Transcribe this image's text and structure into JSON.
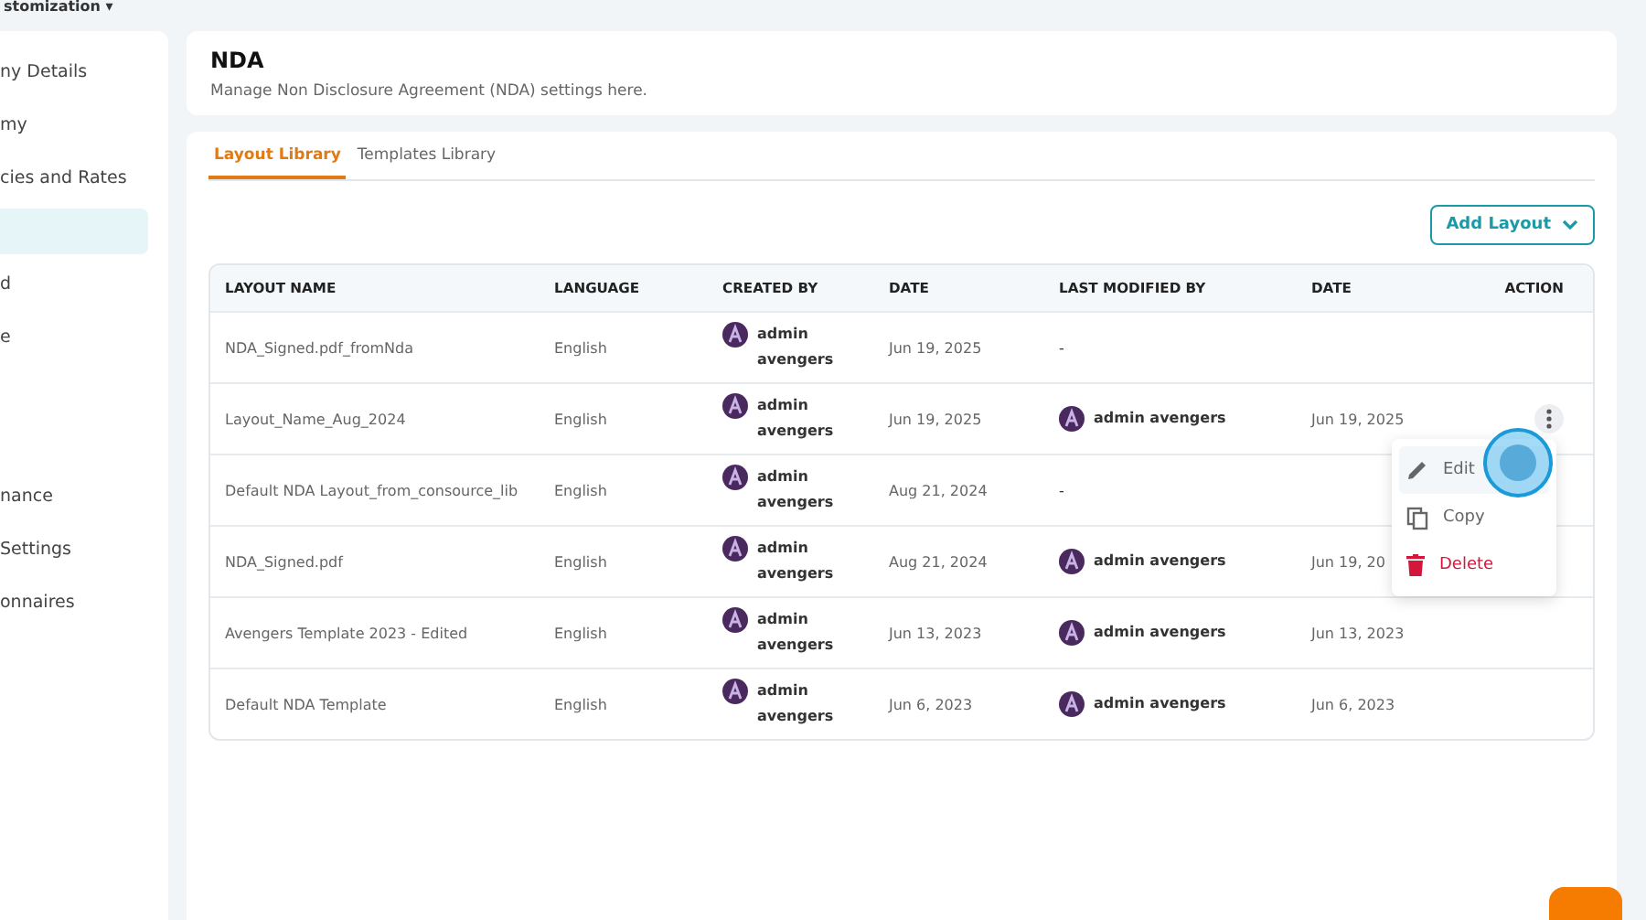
{
  "breadcrumb": {
    "label": "stomization",
    "caret": "▾"
  },
  "sidebar": {
    "items": [
      {
        "label": "ny Details",
        "selected": false
      },
      {
        "label": "my",
        "selected": false
      },
      {
        "label": "cies and Rates",
        "selected": false
      },
      {
        "selected": true
      },
      {
        "label": "d",
        "selected": false
      },
      {
        "label": "e",
        "selected": false
      },
      {
        "selected": false
      },
      {
        "selected": false
      },
      {
        "label": "nance",
        "selected": false
      },
      {
        "label": " Settings",
        "selected": false
      },
      {
        "label": "onnaires",
        "selected": false
      }
    ]
  },
  "header": {
    "title": "NDA",
    "subtitle": "Manage Non Disclosure Agreement (NDA) settings here."
  },
  "tabs": [
    {
      "label": "Layout Library",
      "selected": true
    },
    {
      "label": "Templates Library",
      "selected": false
    }
  ],
  "add_button": {
    "label": "Add Layout"
  },
  "table": {
    "columns": [
      "LAYOUT NAME",
      "LANGUAGE",
      "CREATED BY",
      "DATE",
      "LAST MODIFIED BY",
      "DATE",
      "ACTION"
    ],
    "rows": [
      {
        "name": "NDA_Signed.pdf_fromNda",
        "language": "English",
        "created_by": "admin avengers",
        "date": "Jun 19, 2025",
        "modified_by": "-",
        "modified_date": "",
        "menu_open": false
      },
      {
        "name": "Layout_Name_Aug_2024",
        "language": "English",
        "created_by": "admin avengers",
        "date": "Jun 19, 2025",
        "modified_by": "admin avengers",
        "modified_date": "Jun 19, 2025",
        "menu_open": true
      },
      {
        "name": "Default NDA Layout_from_consource_lib",
        "language": "English",
        "created_by": "admin avengers",
        "date": "Aug 21, 2024",
        "modified_by": "-",
        "modified_date": "",
        "menu_open": false
      },
      {
        "name": "NDA_Signed.pdf",
        "language": "English",
        "created_by": "admin avengers",
        "date": "Aug 21, 2024",
        "modified_by": "admin avengers",
        "modified_date": "Jun 19, 20",
        "menu_open": false
      },
      {
        "name": "Avengers Template 2023 - Edited",
        "language": "English",
        "created_by": "admin avengers",
        "date": "Jun 13, 2023",
        "modified_by": "admin avengers",
        "modified_date": "Jun 13, 2023",
        "menu_open": false
      },
      {
        "name": "Default NDA Template",
        "language": "English",
        "created_by": "admin avengers",
        "date": "Jun 6, 2023",
        "modified_by": "admin avengers",
        "modified_date": "Jun 6, 2023",
        "menu_open": false
      }
    ]
  },
  "action_menu": {
    "items": [
      {
        "label": "Edit",
        "kind": "edit",
        "selected": true
      },
      {
        "label": "Copy",
        "kind": "copy",
        "selected": false
      },
      {
        "label": "Delete",
        "kind": "delete",
        "selected": false
      }
    ]
  }
}
